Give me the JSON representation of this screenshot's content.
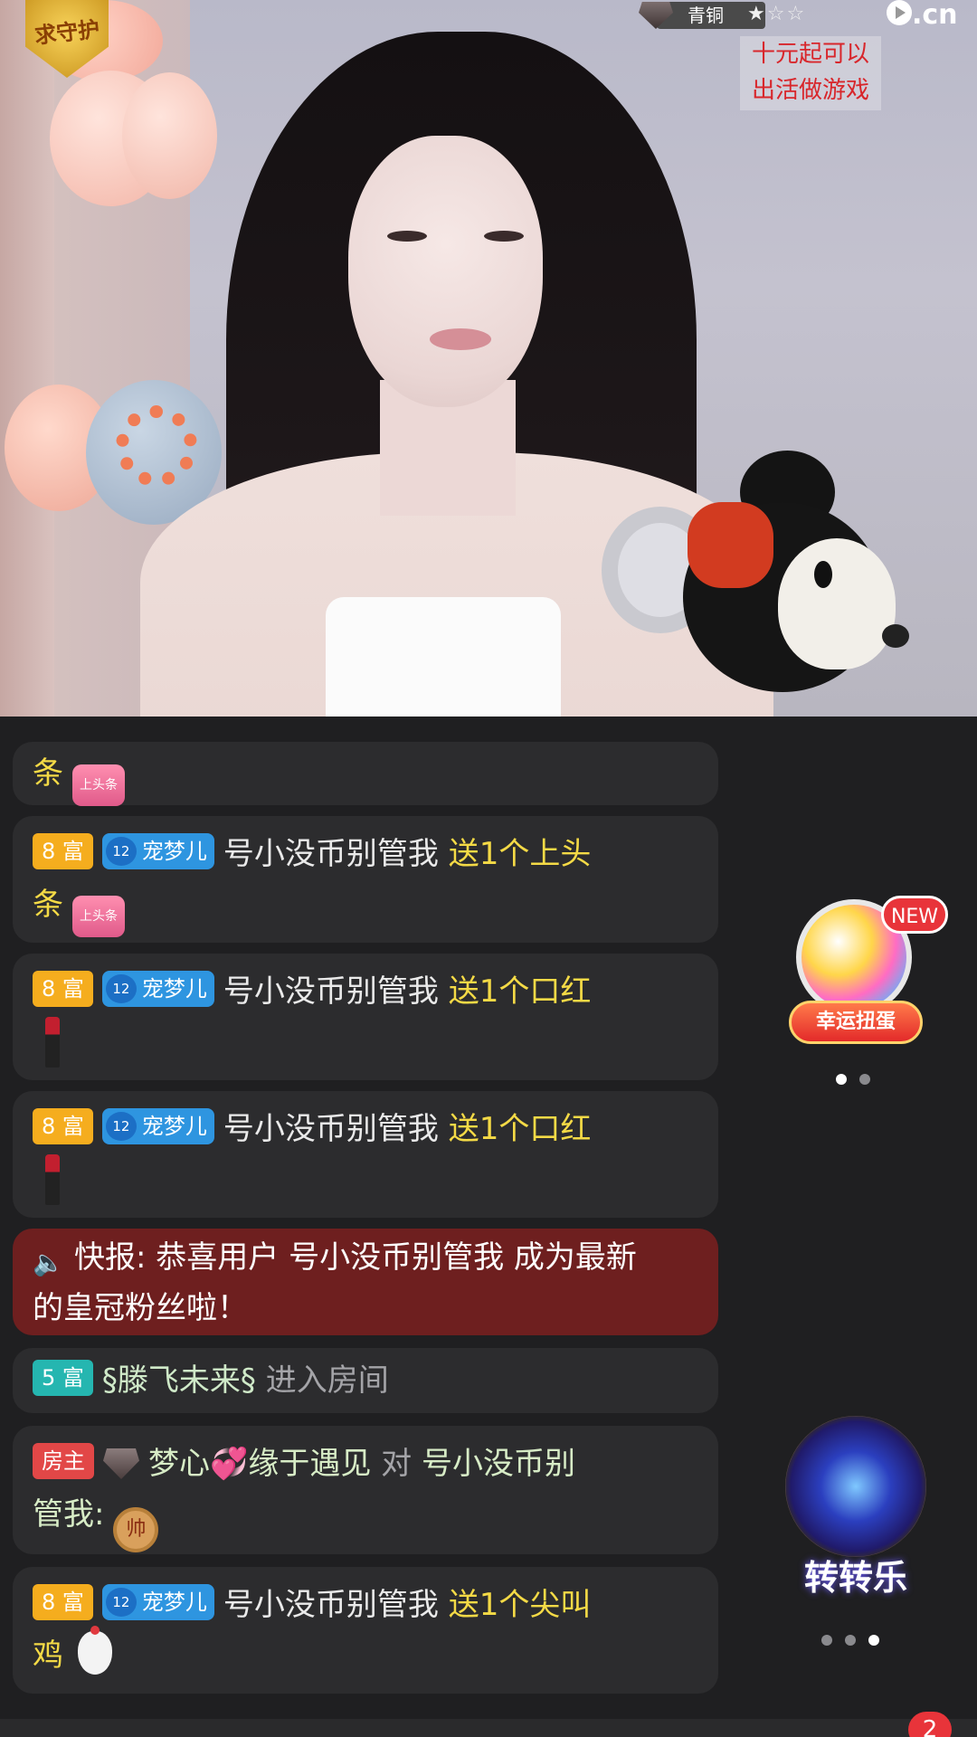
{
  "video_overlay": {
    "guard_badge_text": "求守护",
    "rank_label": "青铜",
    "rank_stars": "★☆☆",
    "logo_text": ".cn",
    "promo_line1": "十元起可以",
    "promo_line2": "出活做游戏"
  },
  "chat": {
    "messages": [
      {
        "tail": "条",
        "gift_icon": "上头条"
      },
      {
        "wealth": "8 富",
        "fan_level": "12",
        "fan_club": "宠梦儿",
        "user": "号小没币别管我",
        "action": "送1个上头",
        "action2": "条",
        "gift_icon": "上头条"
      },
      {
        "wealth": "8 富",
        "fan_level": "12",
        "fan_club": "宠梦儿",
        "user": "号小没币别管我",
        "action": "送1个口红",
        "gift_icon": "lipstick-icon"
      },
      {
        "wealth": "8 富",
        "fan_level": "12",
        "fan_club": "宠梦儿",
        "user": "号小没币别管我",
        "action": "送1个口红",
        "gift_icon": "lipstick-icon"
      },
      {
        "prefix": "快报:",
        "text": "恭喜用户 号小没币别管我 成为最新",
        "text2": "的皇冠粉丝啦！"
      },
      {
        "wealth": "5 富",
        "user": "§滕飞未来§",
        "action": "进入房间"
      },
      {
        "role": "房主",
        "user": "梦心",
        "user2": "缘于遇见",
        "verb": "对",
        "target": "号小没币别",
        "target2": "管我:",
        "gift_text": "帅"
      },
      {
        "wealth": "8 富",
        "fan_level": "12",
        "fan_club": "宠梦儿",
        "user": "号小没币别管我",
        "action": "送1个尖叫",
        "action2": "鸡",
        "gift_icon": "chicken-icon"
      }
    ]
  },
  "side": {
    "egg_new": "NEW",
    "egg_label": "幸运扭蛋",
    "wheel_label": "转转乐",
    "notification_count": "2"
  }
}
